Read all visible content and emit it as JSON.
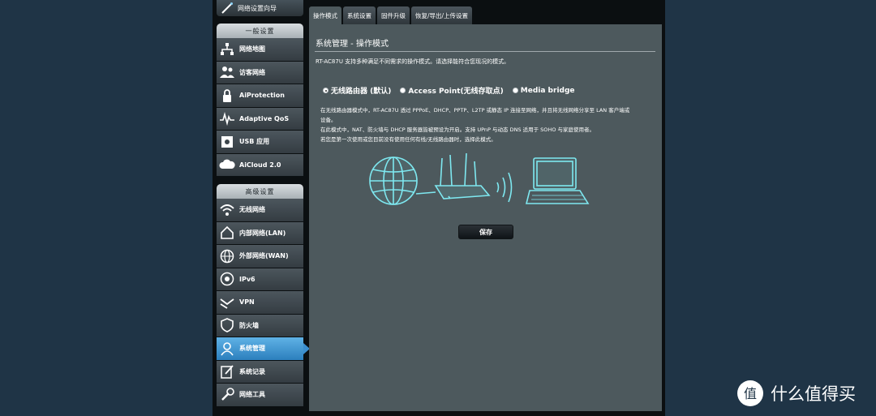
{
  "sidebar": {
    "qis_label": "网络设置向导",
    "general": {
      "heading": "一般设置",
      "items": [
        {
          "label": "网络地图",
          "icon": "network-map-icon"
        },
        {
          "label": "访客网络",
          "icon": "guest-network-icon"
        },
        {
          "label": "AiProtection",
          "icon": "aiprotection-icon"
        },
        {
          "label": "Adaptive QoS",
          "icon": "qos-icon"
        },
        {
          "label": "USB 应用",
          "icon": "usb-app-icon"
        },
        {
          "label": "AiCloud 2.0",
          "icon": "aicloud-icon"
        }
      ]
    },
    "advanced": {
      "heading": "高级设置",
      "items": [
        {
          "label": "无线网络",
          "icon": "wireless-icon"
        },
        {
          "label": "内部网络(LAN)",
          "icon": "lan-icon"
        },
        {
          "label": "外部网络(WAN)",
          "icon": "wan-icon"
        },
        {
          "label": "IPv6",
          "icon": "ipv6-icon"
        },
        {
          "label": "VPN",
          "icon": "vpn-icon"
        },
        {
          "label": "防火墙",
          "icon": "firewall-icon"
        },
        {
          "label": "系统管理",
          "icon": "admin-icon",
          "active": true
        },
        {
          "label": "系统记录",
          "icon": "syslog-icon"
        },
        {
          "label": "网络工具",
          "icon": "network-tools-icon"
        }
      ]
    }
  },
  "tabs": [
    {
      "label": "操作模式",
      "active": true
    },
    {
      "label": "系统设置"
    },
    {
      "label": "固件升级"
    },
    {
      "label": "恢复/导出/上传设置"
    }
  ],
  "content": {
    "title": "系统管理 - 操作模式",
    "intro": "RT-AC87U 支持多种满足不同需求的操作模式。请选择能符合您现况的模式。",
    "modes": [
      {
        "label": "无线路由器 (默认)",
        "selected": true
      },
      {
        "label": "Access Point(无线存取点)",
        "selected": false
      },
      {
        "label": "Media bridge",
        "selected": false
      }
    ],
    "description": [
      "在无线路由器模式中，RT-AC87U 透过 PPPoE、DHCP、PPTP、L2TP 或静态 IP 连接至网络，并且将无线网络分享至 LAN 客户端或",
      "设备。",
      "在此模式中，NAT、防火墙与 DHCP 服务器皆被预设为开启。支持 UPnP 与动态 DNS 适用于 SOHO 与家庭使用者。",
      "若您是第一次使用或您目前没有使用任何有线/无线路由器时，选择此模式。"
    ],
    "save_label": "保存"
  },
  "watermark": {
    "text": "什么值得买",
    "logo_glyph": "值"
  },
  "colors": {
    "background": "#1f3446",
    "panel": "#4d595d",
    "active_item": "#3b8fcf",
    "illustration": "#7ee8f0"
  }
}
